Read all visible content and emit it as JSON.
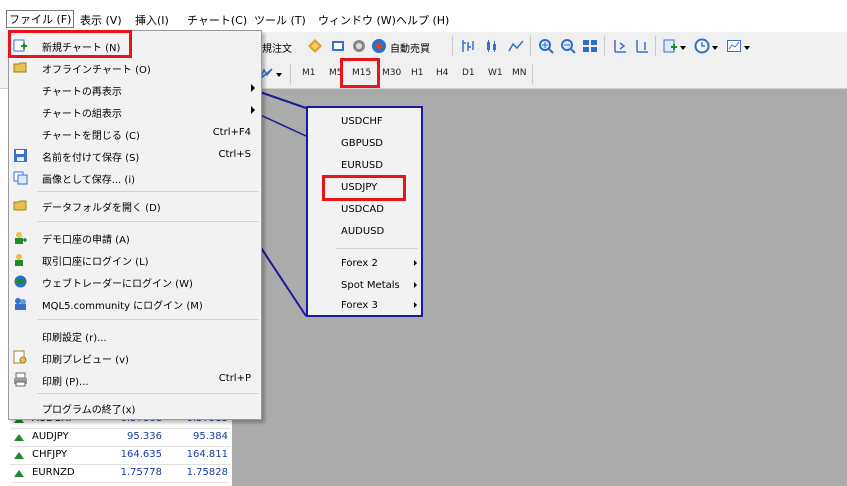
{
  "menubar": {
    "items": [
      "ファイル (F)",
      "表示 (V)",
      "挿入(I)",
      "チャート(C)",
      "ツール (T)",
      "ウィンドウ (W)",
      "ヘルプ (H)"
    ]
  },
  "toolbar1": {
    "new_order_label": "規注文",
    "auto_trade_label": "自動売買"
  },
  "timeframes": [
    "M1",
    "M5",
    "M15",
    "M30",
    "H1",
    "H4",
    "D1",
    "W1",
    "MN"
  ],
  "file_menu": {
    "items": [
      {
        "label": "新規チャート (N)",
        "shortcut": ""
      },
      {
        "label": "オフラインチャート (O)",
        "shortcut": ""
      },
      {
        "label": "チャートの再表示",
        "shortcut": ""
      },
      {
        "label": "チャートの組表示",
        "shortcut": ""
      },
      {
        "label": "チャートを閉じる (C)",
        "shortcut": "Ctrl+F4"
      },
      {
        "label": "名前を付けて保存 (S)",
        "shortcut": "Ctrl+S"
      },
      {
        "label": "画像として保存... (i)",
        "shortcut": ""
      },
      {
        "label": "データフォルダを開く (D)",
        "shortcut": ""
      },
      {
        "label": "デモ口座の申請 (A)",
        "shortcut": ""
      },
      {
        "label": "取引口座にログイン (L)",
        "shortcut": ""
      },
      {
        "label": "ウェブトレーダーにログイン (W)",
        "shortcut": ""
      },
      {
        "label": "MQL5.community にログイン (M)",
        "shortcut": ""
      },
      {
        "label": "印刷設定 (r)...",
        "shortcut": ""
      },
      {
        "label": "印刷プレビュー (v)",
        "shortcut": ""
      },
      {
        "label": "印刷 (P)...",
        "shortcut": "Ctrl+P"
      },
      {
        "label": "プログラムの終了(x)",
        "shortcut": ""
      }
    ]
  },
  "symbol_menu": {
    "items": [
      "USDCHF",
      "GBPUSD",
      "EURUSD",
      "USDJPY",
      "USDCAD",
      "AUDUSD",
      "Forex 2",
      "Spot Metals",
      "Forex 3"
    ]
  },
  "market_watch": {
    "rows": [
      {
        "symbol": "AUDCHF",
        "bid": "0.57861",
        "ask": "0.57915"
      },
      {
        "symbol": "AUDJPY",
        "bid": "95.336",
        "ask": "95.384"
      },
      {
        "symbol": "CHFJPY",
        "bid": "164.635",
        "ask": "164.811"
      },
      {
        "symbol": "EURNZD",
        "bid": "1.75778",
        "ask": "1.75828"
      }
    ]
  },
  "colors": {
    "highlight_red": "#e8141c",
    "submenu_border": "#1a1a9a",
    "chart_bg": "#ababab",
    "menu_bg": "#f2f2f2"
  }
}
